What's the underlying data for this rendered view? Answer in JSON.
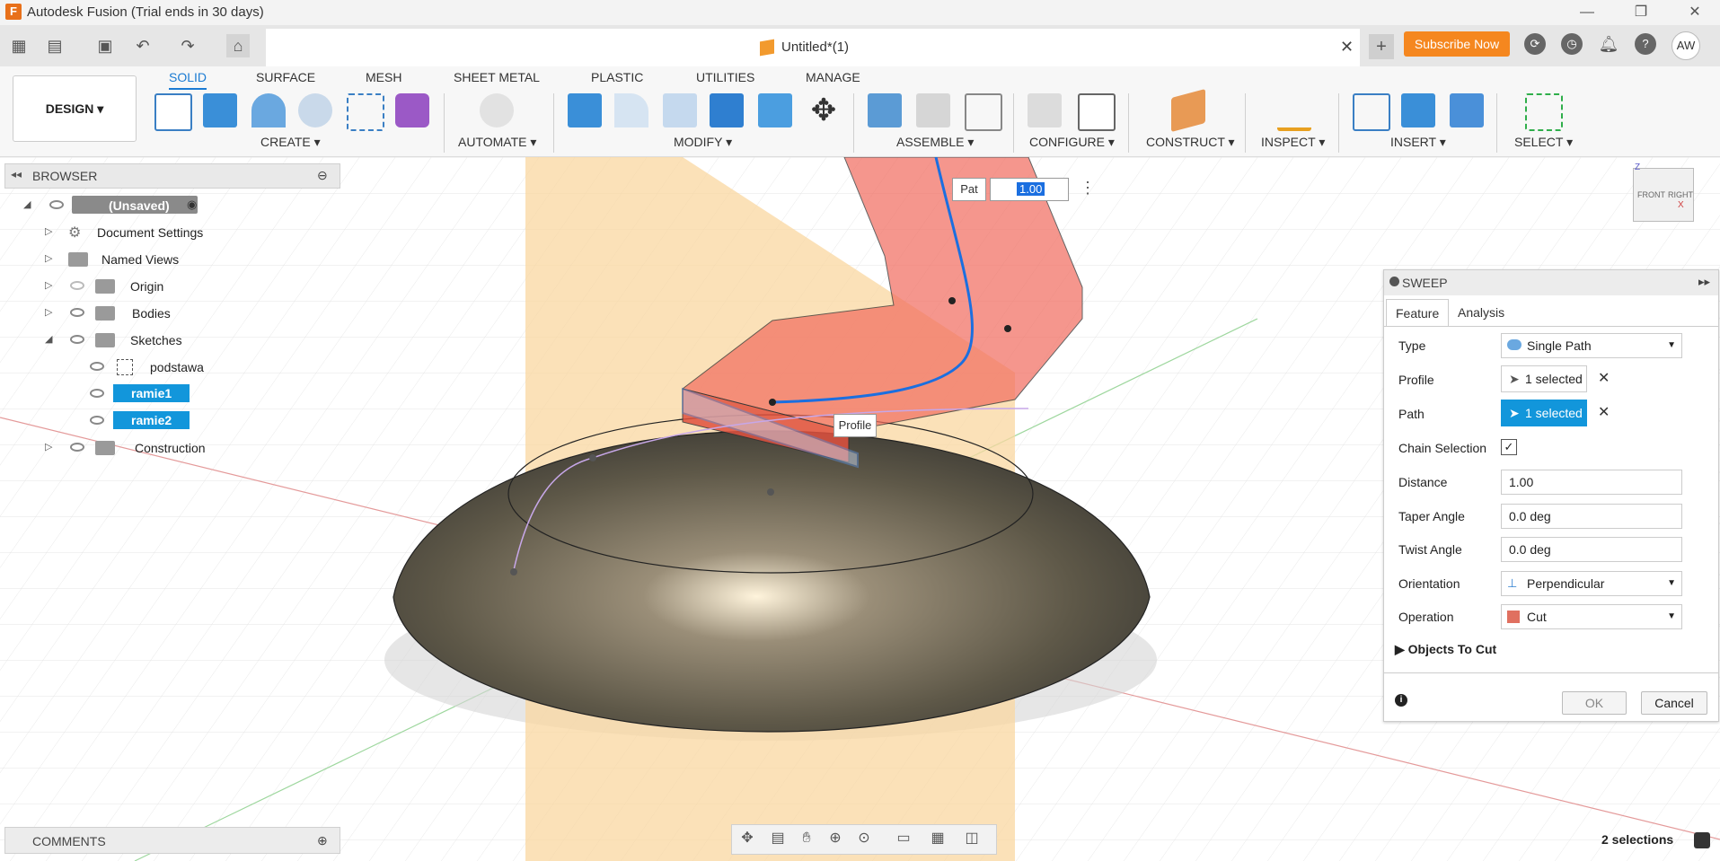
{
  "window": {
    "app_icon": "F",
    "title": "Autodesk Fusion (Trial ends in 30 days)",
    "minimize": "—",
    "restore": "❐",
    "close": "✕"
  },
  "tabbar": {
    "doc_title": "Untitled*(1)",
    "close": "✕",
    "new_tab": "+",
    "subscribe": "Subscribe Now",
    "avatar": "AW"
  },
  "ribbon": {
    "workspace": "DESIGN ▾",
    "tabs": [
      "SOLID",
      "SURFACE",
      "MESH",
      "SHEET METAL",
      "PLASTIC",
      "UTILITIES",
      "MANAGE"
    ],
    "groups": [
      "CREATE ▾",
      "AUTOMATE ▾",
      "MODIFY ▾",
      "ASSEMBLE ▾",
      "CONFIGURE ▾",
      "CONSTRUCT ▾",
      "INSPECT ▾",
      "INSERT ▾",
      "SELECT ▾"
    ]
  },
  "browser": {
    "title": "BROWSER",
    "root": "(Unsaved)",
    "items": [
      "Document Settings",
      "Named Views",
      "Origin",
      "Bodies",
      "Sketches",
      "podstawa",
      "ramie1",
      "ramie2",
      "Construction"
    ]
  },
  "comments": {
    "title": "COMMENTS"
  },
  "viewport": {
    "path_label": "Pat",
    "path_value": "1.00",
    "profile_label": "Profile",
    "viewcube_front": "FRONT",
    "viewcube_right": "RIGHT",
    "axis_z": "Z",
    "axis_x": "X"
  },
  "sweep": {
    "title": "SWEEP",
    "tabs": [
      "Feature",
      "Analysis"
    ],
    "type_label": "Type",
    "type_value": "Single Path",
    "profile_label": "Profile",
    "profile_value": "1 selected",
    "path_label": "Path",
    "path_value": "1 selected",
    "chain_label": "Chain Selection",
    "chain_checked": true,
    "distance_label": "Distance",
    "distance_value": "1.00",
    "taper_label": "Taper Angle",
    "taper_value": "0.0 deg",
    "twist_label": "Twist Angle",
    "twist_value": "0.0 deg",
    "orientation_label": "Orientation",
    "orientation_value": "Perpendicular",
    "operation_label": "Operation",
    "operation_value": "Cut",
    "objects_label": "Objects To Cut",
    "ok": "OK",
    "cancel": "Cancel"
  },
  "status": {
    "selections": "2 selections"
  }
}
